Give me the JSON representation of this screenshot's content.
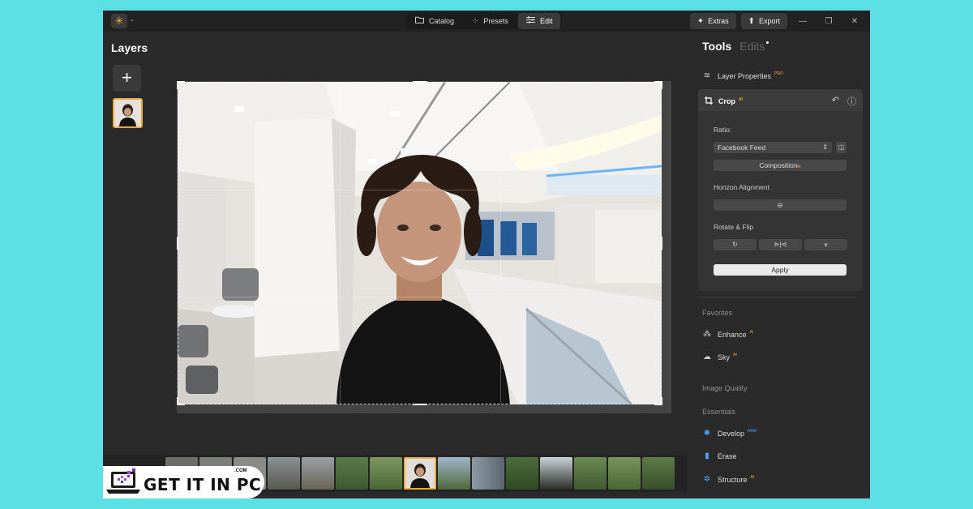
{
  "topbar": {
    "tabs": [
      {
        "label": "Catalog",
        "icon": "folder-icon"
      },
      {
        "label": "Presets",
        "icon": "sparkle-icon"
      },
      {
        "label": "Edit",
        "icon": "sliders-icon"
      }
    ],
    "extras_label": "Extras",
    "export_label": "Export"
  },
  "left": {
    "layers_title": "Layers"
  },
  "right": {
    "tab_tools": "Tools",
    "tab_edits": "Edits",
    "layer_properties": "Layer Properties",
    "layer_properties_badge": "PRO",
    "crop": {
      "title": "Crop",
      "badge": "AI",
      "ratio_label": "Ratio:",
      "ratio_value": "Facebook Feed",
      "composition_label": "Composition",
      "composition_badge": "AI",
      "horizon_label": "Horizon Alignment",
      "rotate_label": "Rotate & Flip",
      "apply_label": "Apply"
    },
    "favorites_title": "Favorites",
    "enhance_label": "Enhance",
    "enhance_badge": "AI",
    "sky_label": "Sky",
    "sky_badge": "AI",
    "image_quality_title": "Image Quality",
    "essentials_title": "Essentials",
    "develop_label": "Develop",
    "develop_badge": "RAW",
    "erase_label": "Erase",
    "structure_label": "Structure",
    "structure_badge": "AI"
  },
  "watermark": {
    "text": "GET IT IN PC",
    "suffix": ".COM"
  },
  "colors": {
    "accent": "#f3a93a",
    "panel": "#343434",
    "background": "#2a2a2a"
  }
}
